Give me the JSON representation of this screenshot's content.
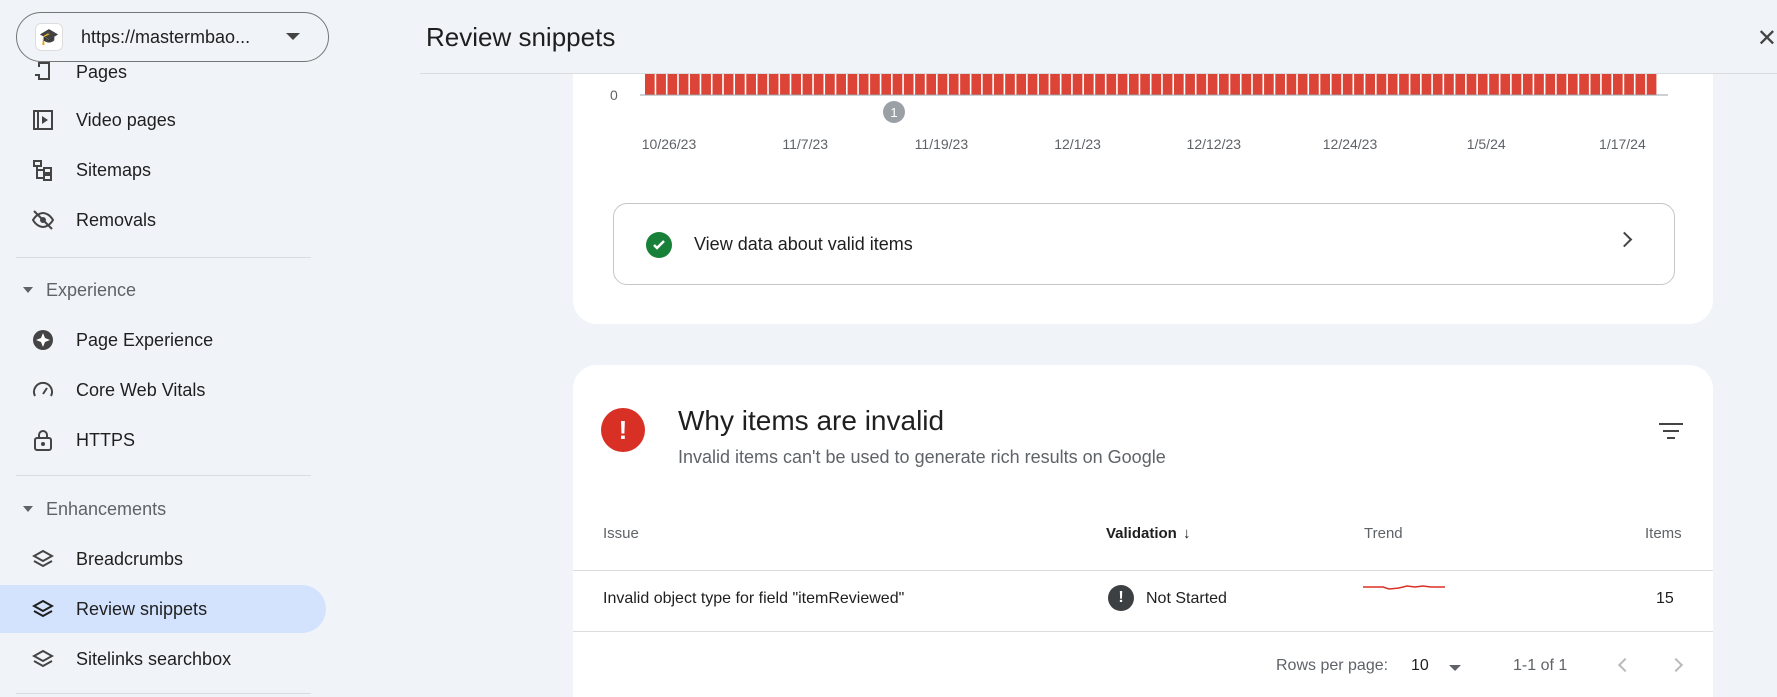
{
  "property": {
    "url": "https://mastermbao...",
    "favicon": "🎓"
  },
  "sidebar": {
    "items_top": [
      {
        "label": "Pages",
        "icon": "pages-icon"
      },
      {
        "label": "Video pages",
        "icon": "video-pages-icon"
      },
      {
        "label": "Sitemaps",
        "icon": "sitemaps-icon"
      },
      {
        "label": "Removals",
        "icon": "removals-icon"
      }
    ],
    "experience": {
      "title": "Experience",
      "items": [
        {
          "label": "Page Experience",
          "icon": "page-experience-icon"
        },
        {
          "label": "Core Web Vitals",
          "icon": "core-web-vitals-icon"
        },
        {
          "label": "HTTPS",
          "icon": "lock-icon"
        }
      ]
    },
    "enhancements": {
      "title": "Enhancements",
      "items": [
        {
          "label": "Breadcrumbs",
          "icon": "layers-icon"
        },
        {
          "label": "Review snippets",
          "icon": "layers-icon",
          "active": true
        },
        {
          "label": "Sitelinks searchbox",
          "icon": "layers-icon"
        }
      ]
    }
  },
  "header": {
    "title": "Review snippets",
    "close": "✕"
  },
  "chart_data": {
    "type": "bar",
    "y_tick": "0",
    "x_ticks": [
      "10/26/23",
      "11/7/23",
      "11/19/23",
      "12/1/23",
      "12/12/23",
      "12/24/23",
      "1/5/24",
      "1/17/24"
    ],
    "annotation": "1",
    "bar_count": 90,
    "bar_color": "#db4437"
  },
  "valid": {
    "label": "View data about valid items"
  },
  "invalid": {
    "badge": "!",
    "title": "Why items are invalid",
    "subtitle": "Invalid items can't be used to generate rich results on Google",
    "columns": {
      "issue": "Issue",
      "validation": "Validation",
      "sort_arrow": "↓",
      "trend": "Trend",
      "items": "Items"
    },
    "rows": [
      {
        "issue": "Invalid object type for field \"itemReviewed\"",
        "status_icon": "!",
        "validation": "Not Started",
        "items": "15"
      }
    ],
    "pager": {
      "rows_label": "Rows per page:",
      "rows_value": "10",
      "range": "1-1 of 1"
    }
  },
  "colors": {
    "accent": "#d3e3fd",
    "error": "#d93025",
    "success": "#188038"
  }
}
